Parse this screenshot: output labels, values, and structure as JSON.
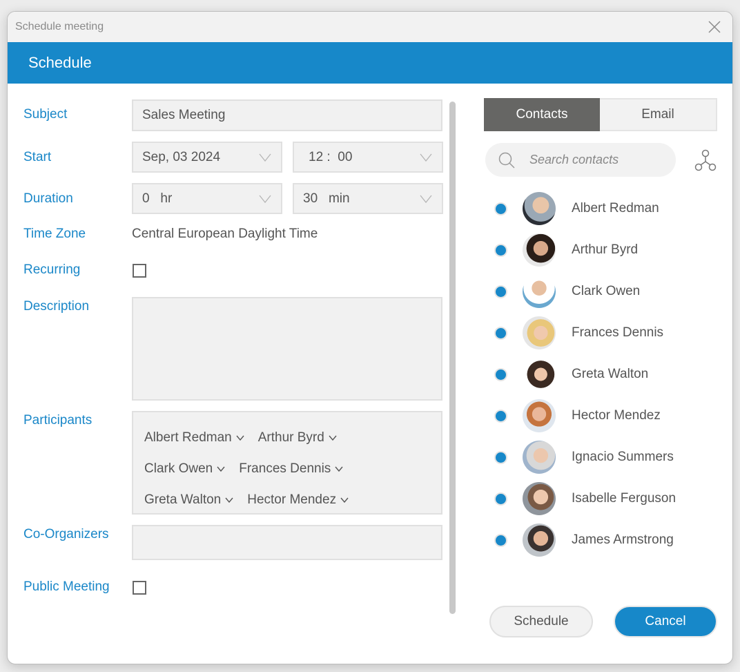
{
  "window": {
    "title": "Schedule meeting"
  },
  "header": {
    "title": "Schedule"
  },
  "form": {
    "subject": {
      "label": "Subject",
      "value": "Sales Meeting"
    },
    "start": {
      "label": "Start",
      "date": "Sep, 03 2024",
      "time": "12 :  00"
    },
    "duration": {
      "label": "Duration",
      "hours": "0   hr",
      "minutes": "30   min"
    },
    "time_zone": {
      "label": "Time Zone",
      "value": "Central European Daylight Time"
    },
    "recurring": {
      "label": "Recurring",
      "checked": false
    },
    "description": {
      "label": "Description",
      "value": ""
    },
    "participants": {
      "label": "Participants",
      "rows": [
        [
          "Albert Redman",
          "Arthur Byrd"
        ],
        [
          "Clark Owen",
          "Frances Dennis"
        ],
        [
          "Greta Walton",
          "Hector Mendez"
        ]
      ]
    },
    "co_organizers": {
      "label": "Co-Organizers",
      "value": ""
    },
    "public_meeting": {
      "label": "Public Meeting",
      "checked": false
    }
  },
  "sidebar": {
    "tabs": [
      {
        "label": "Contacts",
        "active": true
      },
      {
        "label": "Email",
        "active": false
      }
    ],
    "search": {
      "placeholder": "Search contacts",
      "value": ""
    },
    "contacts": [
      {
        "name": "Albert Redman",
        "status": "online"
      },
      {
        "name": "Arthur Byrd",
        "status": "online"
      },
      {
        "name": "Clark Owen",
        "status": "online"
      },
      {
        "name": "Frances Dennis",
        "status": "online"
      },
      {
        "name": "Greta Walton",
        "status": "online"
      },
      {
        "name": "Hector Mendez",
        "status": "online"
      },
      {
        "name": "Ignacio Summers",
        "status": "online"
      },
      {
        "name": "Isabelle Ferguson",
        "status": "online"
      },
      {
        "name": "James Armstrong",
        "status": "online"
      }
    ]
  },
  "actions": {
    "schedule_label": "Schedule",
    "cancel_label": "Cancel"
  },
  "colors": {
    "accent": "#1788c9",
    "label": "#1a87c8",
    "active_tab": "#666664"
  }
}
